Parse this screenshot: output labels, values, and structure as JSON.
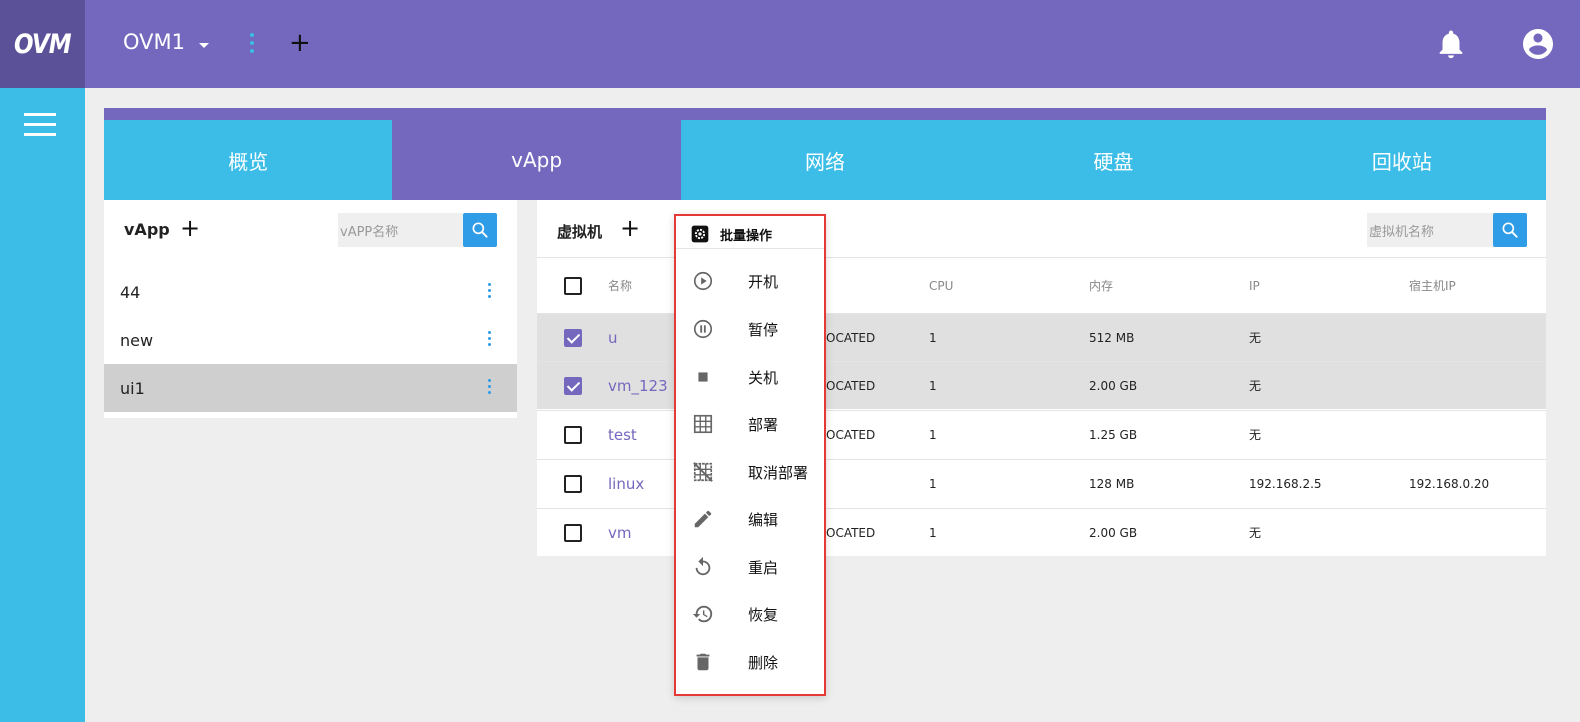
{
  "app": {
    "logo": "OVM",
    "env_name": "OVM1"
  },
  "tabs": [
    "概览",
    "vApp",
    "网络",
    "硬盘",
    "回收站"
  ],
  "vapp_panel": {
    "title": "vApp",
    "search_placeholder": "vAPP名称",
    "items": [
      "44",
      "new",
      "ui1"
    ]
  },
  "vm_panel": {
    "title": "虚拟机",
    "search_placeholder": "虚拟机名称",
    "headers": {
      "name": "名称",
      "cpu": "CPU",
      "memory": "内存",
      "ip": "IP",
      "host_ip": "宿主机IP"
    },
    "rows": [
      {
        "name": "u",
        "status": "OCATED",
        "cpu": "1",
        "memory": "512 MB",
        "ip": "无",
        "host_ip": "",
        "checked": true
      },
      {
        "name": "vm_123",
        "status": "OCATED",
        "cpu": "1",
        "memory": "2.00 GB",
        "ip": "无",
        "host_ip": "",
        "checked": true
      },
      {
        "name": "test",
        "status": "OCATED",
        "cpu": "1",
        "memory": "1.25 GB",
        "ip": "无",
        "host_ip": "",
        "checked": false
      },
      {
        "name": "linux",
        "status": "",
        "cpu": "1",
        "memory": "128 MB",
        "ip": "192.168.2.5",
        "host_ip": "192.168.0.20",
        "checked": false
      },
      {
        "name": "vm",
        "status": "OCATED",
        "cpu": "1",
        "memory": "2.00 GB",
        "ip": "无",
        "host_ip": "",
        "checked": false
      }
    ]
  },
  "batch_menu": {
    "title": "批量操作",
    "items": [
      {
        "label": "开机",
        "icon": "play-circle-icon"
      },
      {
        "label": "暂停",
        "icon": "pause-circle-icon"
      },
      {
        "label": "关机",
        "icon": "stop-icon"
      },
      {
        "label": "部署",
        "icon": "grid-icon"
      },
      {
        "label": "取消部署",
        "icon": "grid-off-icon"
      },
      {
        "label": "编辑",
        "icon": "pencil-icon"
      },
      {
        "label": "重启",
        "icon": "restart-icon"
      },
      {
        "label": "恢复",
        "icon": "history-icon"
      },
      {
        "label": "删除",
        "icon": "trash-icon"
      }
    ]
  },
  "colors": {
    "primary": "#7467be",
    "accent": "#3bbde8",
    "button": "#2f9ce8",
    "highlight_border": "#e53935"
  }
}
